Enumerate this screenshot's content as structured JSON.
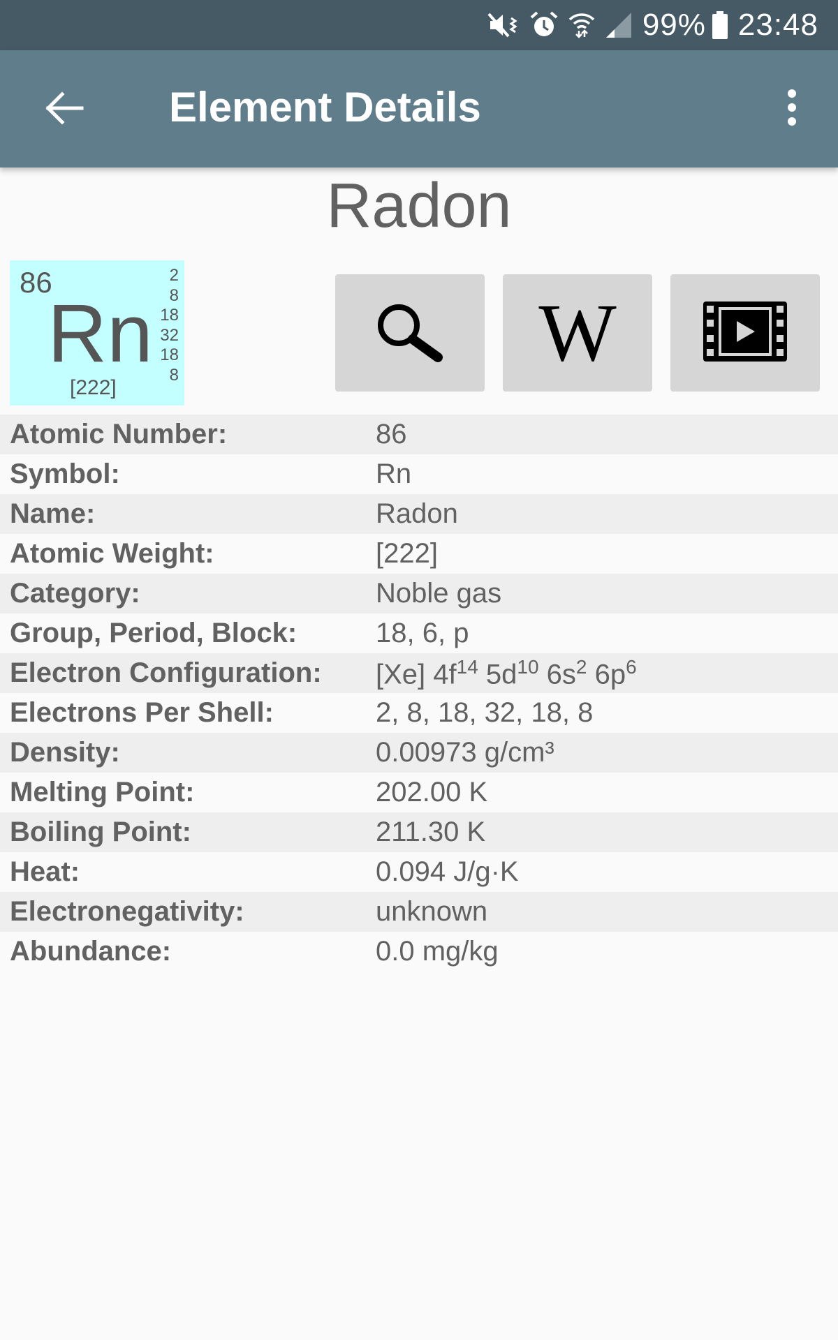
{
  "status_bar": {
    "battery_percent": "99%",
    "time": "23:48",
    "icons": [
      "mute-vibrate-icon",
      "alarm-icon",
      "wifi-icon",
      "signal-icon",
      "battery-icon"
    ]
  },
  "app_bar": {
    "title": "Element Details",
    "back_icon": "arrow-back-icon",
    "menu_icon": "more-vert-icon"
  },
  "element": {
    "name": "Radon",
    "atomic_number": "86",
    "symbol": "Rn",
    "mass": "[222]",
    "shells": [
      "2",
      "8",
      "18",
      "32",
      "18",
      "8"
    ],
    "tile_color": "#c2fffe"
  },
  "actions": {
    "search_icon": "search-icon",
    "wiki_label": "W",
    "video_icon": "video-icon"
  },
  "details": {
    "rows": [
      {
        "label": "Atomic Number:",
        "value": "86"
      },
      {
        "label": "Symbol:",
        "value": "Rn"
      },
      {
        "label": "Name:",
        "value": "Radon"
      },
      {
        "label": "Atomic Weight:",
        "value": "[222]"
      },
      {
        "label": "Category:",
        "value": "Noble gas"
      },
      {
        "label": "Group, Period, Block:",
        "value": "18, 6, p"
      },
      {
        "label": "Electron Configuration:",
        "value": "[Xe] 4f14 5d10 6s2 6p6"
      },
      {
        "label": "Electrons Per Shell:",
        "value": "2, 8, 18, 32, 18, 8"
      },
      {
        "label": "Density:",
        "value": "0.00973 g/cm³"
      },
      {
        "label": "Melting Point:",
        "value": "202.00 K"
      },
      {
        "label": "Boiling Point:",
        "value": "211.30 K"
      },
      {
        "label": "Heat:",
        "value": "0.094 J/g·K"
      },
      {
        "label": "Electronegativity:",
        "value": "unknown"
      },
      {
        "label": "Abundance:",
        "value": "0.0 mg/kg"
      }
    ],
    "electron_configuration_parts": [
      {
        "base": "[Xe] 4f",
        "sup": "14"
      },
      {
        "base": " 5d",
        "sup": "10"
      },
      {
        "base": " 6s",
        "sup": "2"
      },
      {
        "base": " 6p",
        "sup": "6"
      }
    ]
  },
  "colors": {
    "status_bar": "#455a64",
    "app_bar": "#607d8b",
    "text": "#616161",
    "row_shade": "#eeeeee",
    "button_bg": "#d6d6d6"
  }
}
